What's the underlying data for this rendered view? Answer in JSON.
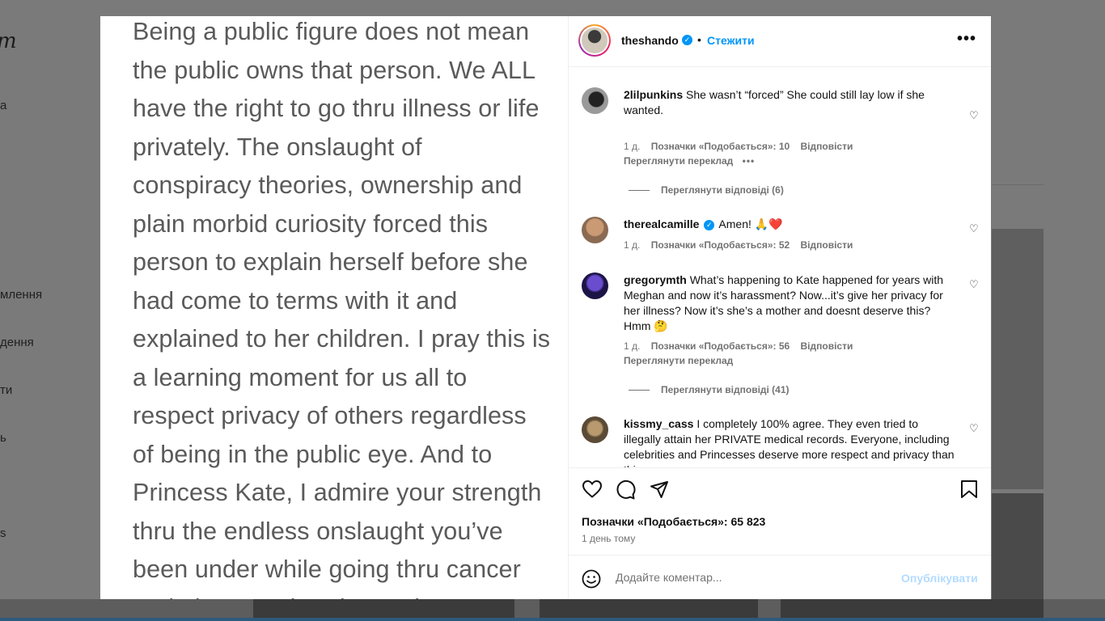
{
  "background": {
    "logo": "m",
    "nav_items": [
      "а",
      "млення",
      "дення",
      "ти",
      "ь",
      "s"
    ]
  },
  "post": {
    "image_text": "Being a public figure does not mean\nthe public owns that person. We ALL\nhave the right to go thru illness or life\nprivately.  The onslaught of\nconspiracy theories, ownership and\nplain morbid curiosity forced this\nperson to explain herself before she\nhad come to terms with it and\nexplained to her children. I pray this is\na learning moment for us all to\nrespect privacy of others regardless\nof being in the public eye. And to\nPrincess Kate, I admire your strength\nthru the endless onslaught you’ve\nbeen under while going thru cancer\nand along Mothood to make"
  },
  "header": {
    "username": "theshando",
    "dot": "•",
    "follow_label": "Стежити",
    "more_label": "•••"
  },
  "comments": [
    {
      "username": "2lilpunkins",
      "text": "She wasn’t “forced” She could still lay low if she wanted.",
      "time": "1 д.",
      "likes": "Позначки «Подобається»: 10",
      "reply": "Відповісти",
      "translate": "Переглянути переклад",
      "more": "•••",
      "view_replies": "Переглянути відповіді (6)"
    },
    {
      "username": "therealcamille",
      "text": "Amen! 🙏❤️",
      "time": "1 д.",
      "likes": "Позначки «Подобається»: 52",
      "reply": "Відповісти"
    },
    {
      "username": "gregorymth",
      "text": "What’s happening to Kate happened for years with Meghan and now it’s harassment? Now...it’s give her privacy for her illness? Now it’s she’s a mother and doesnt deserve this? Hmm 🤔",
      "time": "1 д.",
      "likes": "Позначки «Подобається»: 56",
      "reply": "Відповісти",
      "translate": "Переглянути переклад",
      "view_replies": "Переглянути відповіді (41)"
    },
    {
      "username": "kissmy_cass",
      "text": "I completely 100% agree. They even tried to illegally attain her PRIVATE medical records. Everyone, including celebrities and Princesses deserve more respect and privacy than this."
    }
  ],
  "footer": {
    "likes": "Позначки «Подобається»: 65 823",
    "time": "1 день тому",
    "comment_placeholder": "Додайте коментар...",
    "publish_label": "Опублікувати"
  },
  "colors": {
    "accent": "#0095f6",
    "publish_disabled": "#b3dbff",
    "muted": "#737373",
    "overlay": "#7a7a7a"
  },
  "icons": [
    "heart-icon",
    "comment-icon",
    "share-icon",
    "bookmark-icon",
    "emoji-icon",
    "verified-icon",
    "more-icon"
  ]
}
